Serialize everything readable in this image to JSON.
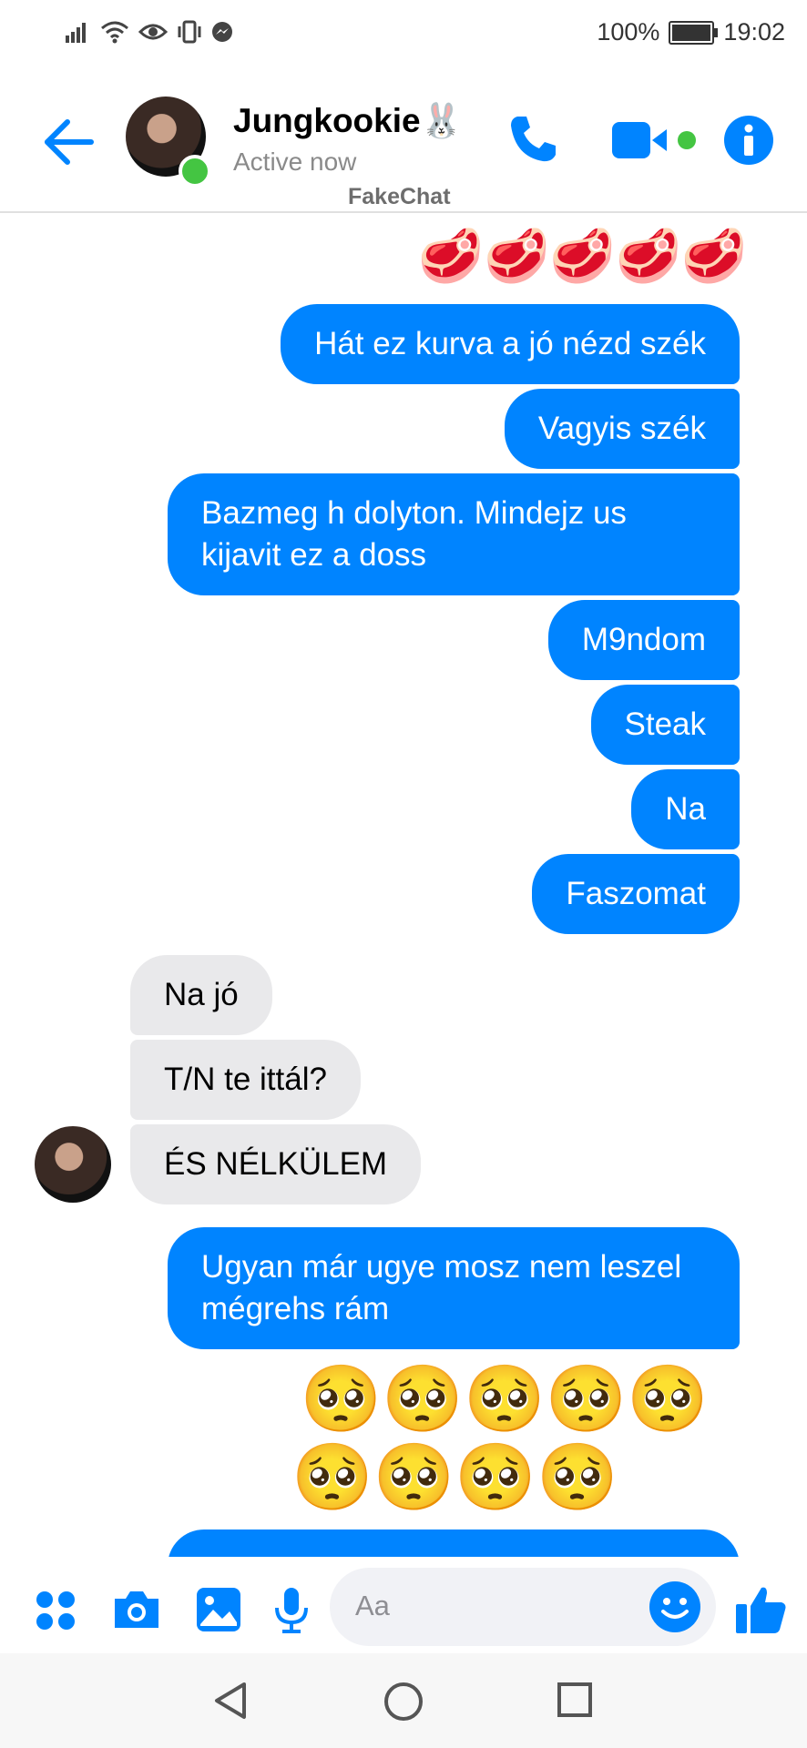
{
  "status_bar": {
    "battery_percent": "100%",
    "time": "19:02",
    "icons": [
      "signal-icon",
      "wifi-icon",
      "eye-icon",
      "vibrate-icon",
      "messenger-notification-icon",
      "battery-charging-icon"
    ]
  },
  "header": {
    "contact_name": "Jungkookie🐰",
    "status": "Active now",
    "watermark": "FakeChat",
    "accent_color": "#0084ff",
    "online_color": "#44c542"
  },
  "messages": [
    {
      "side": "out",
      "type": "emoji",
      "text": "🥩🥩🥩🥩🥩"
    },
    {
      "side": "out",
      "type": "text",
      "text": "Hát ez kurva a jó nézd szék"
    },
    {
      "side": "out",
      "type": "text",
      "text": "Vagyis szék"
    },
    {
      "side": "out",
      "type": "text",
      "text": "Bazmeg h dolyton. Mindejz us kijavit ez a doss"
    },
    {
      "side": "out",
      "type": "text",
      "text": "M9ndom"
    },
    {
      "side": "out",
      "type": "text",
      "text": "Steak"
    },
    {
      "side": "out",
      "type": "text",
      "text": "Na"
    },
    {
      "side": "out",
      "type": "text",
      "text": "Faszomat"
    },
    {
      "side": "in",
      "type": "text",
      "text": "Na jó"
    },
    {
      "side": "in",
      "type": "text",
      "text": "T/N te ittál?"
    },
    {
      "side": "in",
      "type": "text",
      "text": "ÉS NÉLKÜLEM"
    },
    {
      "side": "out",
      "type": "text",
      "text": "Ugyan már ugye mosz nem leszel mégrehs rám"
    },
    {
      "side": "out",
      "type": "emoji",
      "text": "🥺🥺🥺🥺🥺"
    },
    {
      "side": "out",
      "type": "emoji",
      "text": "🥺🥺🥺🥺"
    }
  ],
  "composer": {
    "placeholder": "Aa",
    "icons": [
      "apps-icon",
      "camera-icon",
      "gallery-icon",
      "microphone-icon",
      "emoji-icon",
      "like-icon"
    ]
  },
  "nav_bar": {
    "icons": [
      "back-triangle-icon",
      "home-circle-icon",
      "recents-square-icon"
    ]
  }
}
